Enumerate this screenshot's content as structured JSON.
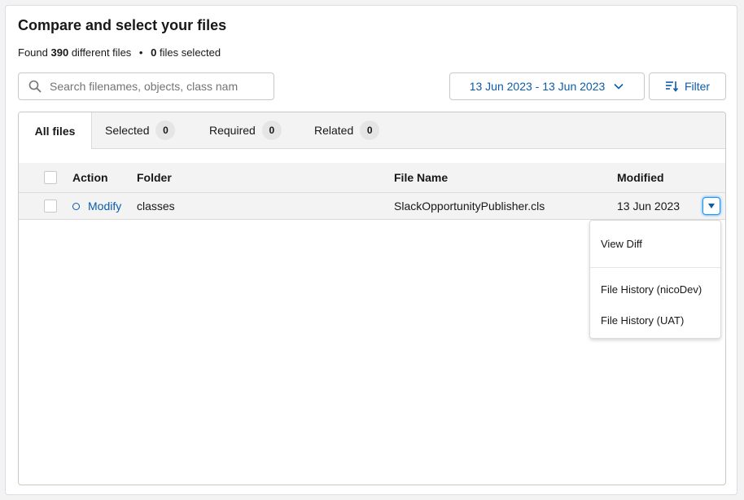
{
  "header": {
    "title": "Compare and select your files",
    "found_prefix": "Found",
    "found_count": "390",
    "found_suffix": "different files",
    "separator": "•",
    "selected_count": "0",
    "selected_suffix": "files selected"
  },
  "search": {
    "placeholder": "Search filenames, objects, class nam",
    "value": ""
  },
  "date_range": {
    "label": "13 Jun 2023 - 13 Jun 2023"
  },
  "filter": {
    "label": "Filter"
  },
  "tabs": [
    {
      "label": "All files",
      "count": null,
      "active": true
    },
    {
      "label": "Selected",
      "count": "0",
      "active": false
    },
    {
      "label": "Required",
      "count": "0",
      "active": false
    },
    {
      "label": "Related",
      "count": "0",
      "active": false
    }
  ],
  "table": {
    "columns": [
      "Action",
      "Folder",
      "File Name",
      "Modified"
    ],
    "rows": [
      {
        "action": "Modify",
        "folder": "classes",
        "file_name": "SlackOpportunityPublisher.cls",
        "modified": "13 Jun 2023"
      }
    ]
  },
  "row_menu": {
    "items": [
      "View Diff",
      "File History (nicoDev)",
      "File History (UAT)"
    ]
  },
  "colors": {
    "accent": "#0b5cab",
    "focus": "#1b96ff",
    "border": "#c9c9c9",
    "header_bg": "#f3f3f3"
  },
  "icons": {
    "search": "search-icon",
    "date_dropdown": "chevron-down-icon",
    "filter": "filter-list-icon",
    "row_menu": "caret-down-icon",
    "status": "status-circle-icon"
  }
}
